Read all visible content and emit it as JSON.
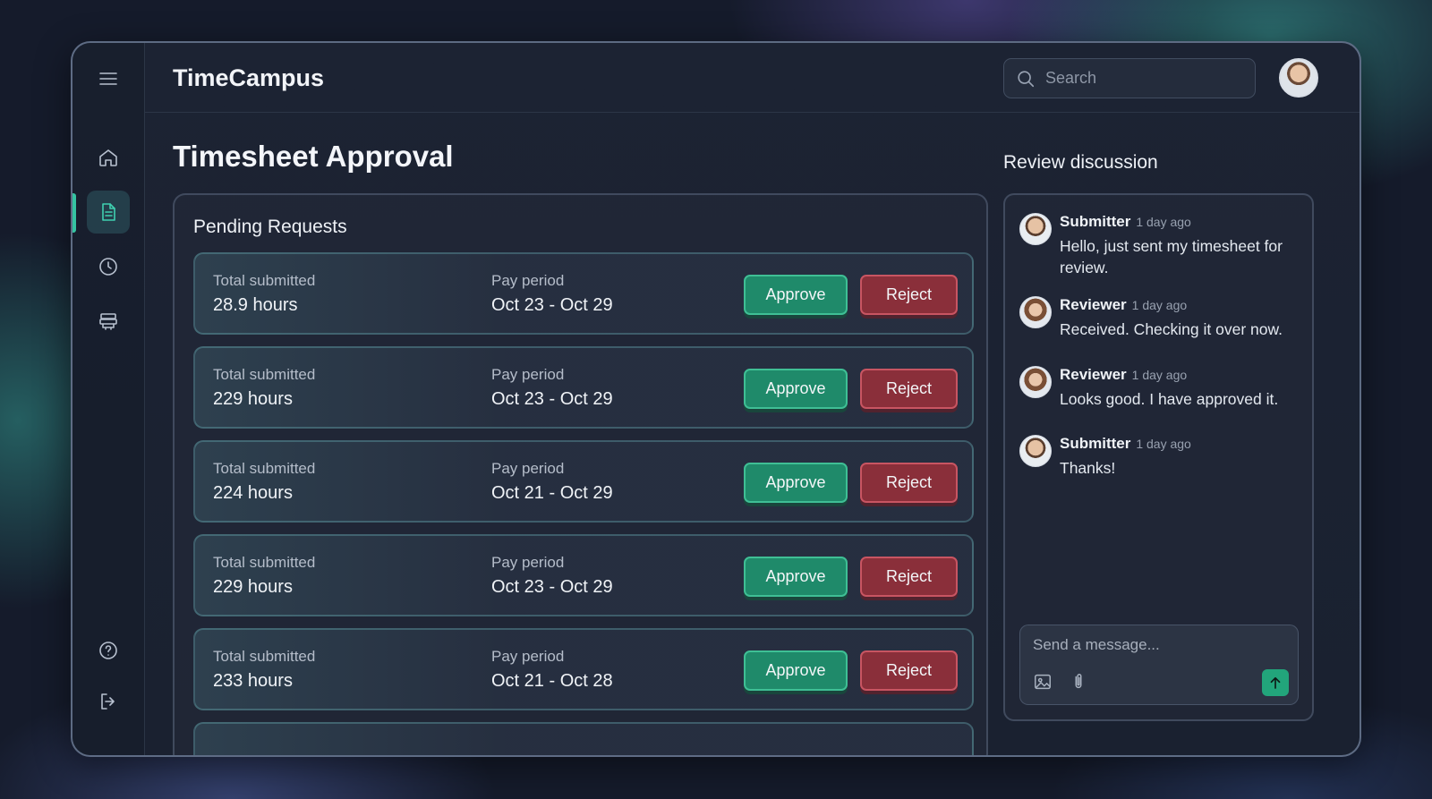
{
  "app": {
    "title": "TimeCampus"
  },
  "search": {
    "placeholder": "Search"
  },
  "sidebar": {
    "items": [
      {
        "name": "menu",
        "icon": "menu-icon"
      },
      {
        "name": "home",
        "icon": "home-icon"
      },
      {
        "name": "timesheets",
        "icon": "document-icon",
        "active": true
      },
      {
        "name": "time",
        "icon": "clock-icon"
      },
      {
        "name": "stack",
        "icon": "layers-icon"
      },
      {
        "name": "help",
        "icon": "help-icon"
      },
      {
        "name": "logout",
        "icon": "logout-icon"
      }
    ]
  },
  "page": {
    "title": "Timesheet Approval"
  },
  "pending": {
    "title": "Pending Requests",
    "total_label": "Total submitted",
    "period_label": "Pay period",
    "approve_label": "Approve",
    "reject_label": "Reject",
    "requests": [
      {
        "hours": "28.9 hours",
        "period": "Oct 23 - Oct 29"
      },
      {
        "hours": "229 hours",
        "period": "Oct 23 - Oct 29"
      },
      {
        "hours": "224 hours",
        "period": "Oct 21 - Oct 29"
      },
      {
        "hours": "229 hours",
        "period": "Oct 23 - Oct 29"
      },
      {
        "hours": "233 hours",
        "period": "Oct 21 - Oct 28"
      }
    ]
  },
  "discussion": {
    "title": "Review discussion",
    "messages": [
      {
        "author": "Submitter",
        "time": "1 day ago",
        "text": "Hello, just sent my timesheet for review."
      },
      {
        "author": "Reviewer",
        "time": "1 day ago",
        "text": "Received. Checking it over now."
      },
      {
        "author": "Reviewer",
        "time": "1 day ago",
        "text": "Looks good. I have approved it."
      },
      {
        "author": "Submitter",
        "time": "1 day ago",
        "text": "Thanks!"
      }
    ],
    "composer_placeholder": "Send a message..."
  },
  "colors": {
    "accent": "#35c4a2",
    "approve": "#1f8a6a",
    "reject": "#8a2f3a",
    "background": "#151b2b"
  }
}
